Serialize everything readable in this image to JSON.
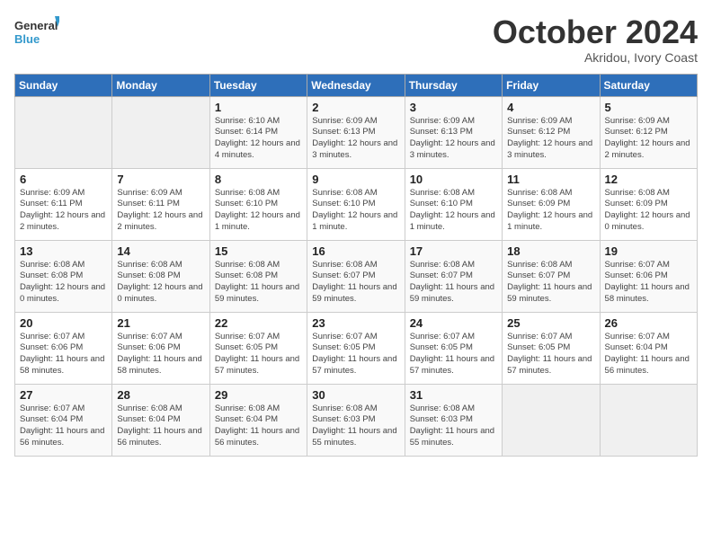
{
  "logo": {
    "line1": "General",
    "line2": "Blue"
  },
  "header": {
    "month": "October 2024",
    "location": "Akridou, Ivory Coast"
  },
  "weekdays": [
    "Sunday",
    "Monday",
    "Tuesday",
    "Wednesday",
    "Thursday",
    "Friday",
    "Saturday"
  ],
  "weeks": [
    [
      {
        "day": "",
        "info": ""
      },
      {
        "day": "",
        "info": ""
      },
      {
        "day": "1",
        "info": "Sunrise: 6:10 AM\nSunset: 6:14 PM\nDaylight: 12 hours and 4 minutes."
      },
      {
        "day": "2",
        "info": "Sunrise: 6:09 AM\nSunset: 6:13 PM\nDaylight: 12 hours and 3 minutes."
      },
      {
        "day": "3",
        "info": "Sunrise: 6:09 AM\nSunset: 6:13 PM\nDaylight: 12 hours and 3 minutes."
      },
      {
        "day": "4",
        "info": "Sunrise: 6:09 AM\nSunset: 6:12 PM\nDaylight: 12 hours and 3 minutes."
      },
      {
        "day": "5",
        "info": "Sunrise: 6:09 AM\nSunset: 6:12 PM\nDaylight: 12 hours and 2 minutes."
      }
    ],
    [
      {
        "day": "6",
        "info": "Sunrise: 6:09 AM\nSunset: 6:11 PM\nDaylight: 12 hours and 2 minutes."
      },
      {
        "day": "7",
        "info": "Sunrise: 6:09 AM\nSunset: 6:11 PM\nDaylight: 12 hours and 2 minutes."
      },
      {
        "day": "8",
        "info": "Sunrise: 6:08 AM\nSunset: 6:10 PM\nDaylight: 12 hours and 1 minute."
      },
      {
        "day": "9",
        "info": "Sunrise: 6:08 AM\nSunset: 6:10 PM\nDaylight: 12 hours and 1 minute."
      },
      {
        "day": "10",
        "info": "Sunrise: 6:08 AM\nSunset: 6:10 PM\nDaylight: 12 hours and 1 minute."
      },
      {
        "day": "11",
        "info": "Sunrise: 6:08 AM\nSunset: 6:09 PM\nDaylight: 12 hours and 1 minute."
      },
      {
        "day": "12",
        "info": "Sunrise: 6:08 AM\nSunset: 6:09 PM\nDaylight: 12 hours and 0 minutes."
      }
    ],
    [
      {
        "day": "13",
        "info": "Sunrise: 6:08 AM\nSunset: 6:08 PM\nDaylight: 12 hours and 0 minutes."
      },
      {
        "day": "14",
        "info": "Sunrise: 6:08 AM\nSunset: 6:08 PM\nDaylight: 12 hours and 0 minutes."
      },
      {
        "day": "15",
        "info": "Sunrise: 6:08 AM\nSunset: 6:08 PM\nDaylight: 11 hours and 59 minutes."
      },
      {
        "day": "16",
        "info": "Sunrise: 6:08 AM\nSunset: 6:07 PM\nDaylight: 11 hours and 59 minutes."
      },
      {
        "day": "17",
        "info": "Sunrise: 6:08 AM\nSunset: 6:07 PM\nDaylight: 11 hours and 59 minutes."
      },
      {
        "day": "18",
        "info": "Sunrise: 6:08 AM\nSunset: 6:07 PM\nDaylight: 11 hours and 59 minutes."
      },
      {
        "day": "19",
        "info": "Sunrise: 6:07 AM\nSunset: 6:06 PM\nDaylight: 11 hours and 58 minutes."
      }
    ],
    [
      {
        "day": "20",
        "info": "Sunrise: 6:07 AM\nSunset: 6:06 PM\nDaylight: 11 hours and 58 minutes."
      },
      {
        "day": "21",
        "info": "Sunrise: 6:07 AM\nSunset: 6:06 PM\nDaylight: 11 hours and 58 minutes."
      },
      {
        "day": "22",
        "info": "Sunrise: 6:07 AM\nSunset: 6:05 PM\nDaylight: 11 hours and 57 minutes."
      },
      {
        "day": "23",
        "info": "Sunrise: 6:07 AM\nSunset: 6:05 PM\nDaylight: 11 hours and 57 minutes."
      },
      {
        "day": "24",
        "info": "Sunrise: 6:07 AM\nSunset: 6:05 PM\nDaylight: 11 hours and 57 minutes."
      },
      {
        "day": "25",
        "info": "Sunrise: 6:07 AM\nSunset: 6:05 PM\nDaylight: 11 hours and 57 minutes."
      },
      {
        "day": "26",
        "info": "Sunrise: 6:07 AM\nSunset: 6:04 PM\nDaylight: 11 hours and 56 minutes."
      }
    ],
    [
      {
        "day": "27",
        "info": "Sunrise: 6:07 AM\nSunset: 6:04 PM\nDaylight: 11 hours and 56 minutes."
      },
      {
        "day": "28",
        "info": "Sunrise: 6:08 AM\nSunset: 6:04 PM\nDaylight: 11 hours and 56 minutes."
      },
      {
        "day": "29",
        "info": "Sunrise: 6:08 AM\nSunset: 6:04 PM\nDaylight: 11 hours and 56 minutes."
      },
      {
        "day": "30",
        "info": "Sunrise: 6:08 AM\nSunset: 6:03 PM\nDaylight: 11 hours and 55 minutes."
      },
      {
        "day": "31",
        "info": "Sunrise: 6:08 AM\nSunset: 6:03 PM\nDaylight: 11 hours and 55 minutes."
      },
      {
        "day": "",
        "info": ""
      },
      {
        "day": "",
        "info": ""
      }
    ]
  ]
}
